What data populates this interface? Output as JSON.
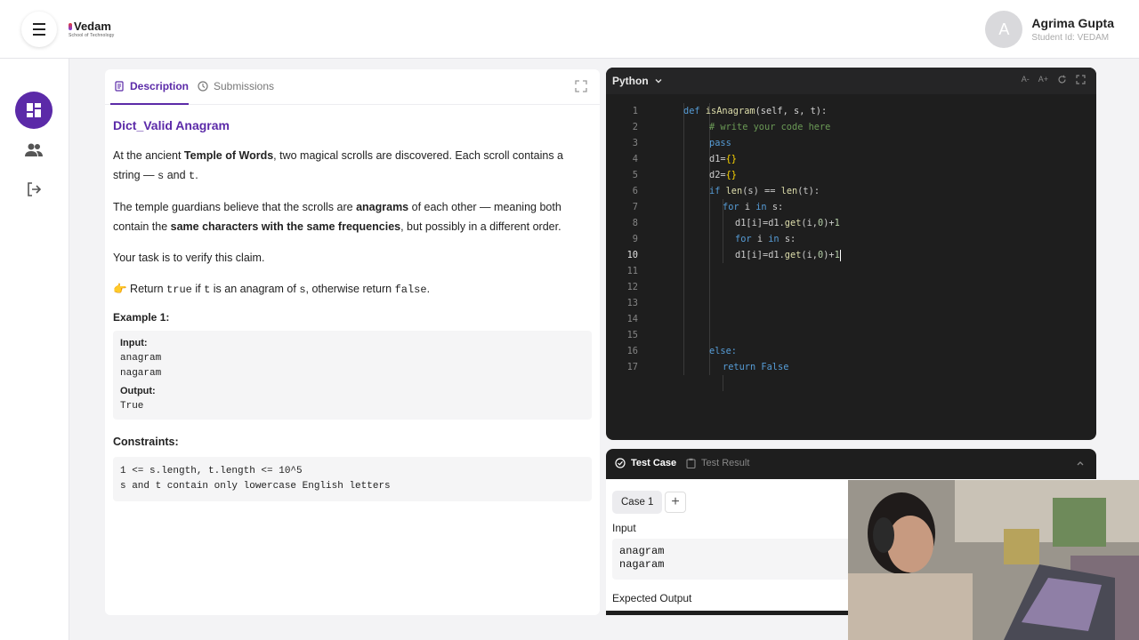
{
  "header": {
    "logo_text": "Vedam",
    "logo_sub": "School of Technology",
    "user_initial": "A",
    "user_name": "Agrima Gupta",
    "student_id": "Student Id: VEDAM"
  },
  "description_panel": {
    "tabs": [
      {
        "label": "Description",
        "icon": "document-icon",
        "active": true
      },
      {
        "label": "Submissions",
        "icon": "clock-icon",
        "active": false
      }
    ],
    "title": "Dict_Valid Anagram",
    "p1_a": "At the ancient ",
    "p1_b": "Temple of Words",
    "p1_c": ", two magical scrolls are discovered. Each scroll contains a string — ",
    "p1_s": "s",
    "p1_and": " and ",
    "p1_t": "t",
    "p1_end": ".",
    "p2_a": "The temple guardians believe that the scrolls are ",
    "p2_b": "anagrams",
    "p2_c": " of each other — meaning both contain the ",
    "p2_d": "same characters with the same frequencies",
    "p2_e": ", but possibly in a different order.",
    "p3": "Your task is to verify this claim.",
    "p4_emoji": "👉",
    "p4_a": " Return ",
    "p4_true": "true",
    "p4_b": " if ",
    "p4_t": "t",
    "p4_c": " is an anagram of ",
    "p4_s": "s",
    "p4_d": ", otherwise return ",
    "p4_false": "false",
    "p4_end": ".",
    "example_title": "Example 1:",
    "example_input_label": "Input:",
    "example_input_1": "anagram",
    "example_input_2": "nagaram",
    "example_output_label": "Output:",
    "example_output": "True",
    "constraints_title": "Constraints:",
    "constraint_1": "1 <= s.length, t.length <= 10^5",
    "constraint_2": "s and t contain only lowercase English letters"
  },
  "editor": {
    "language": "Python",
    "tools": [
      "A-",
      "A+",
      "reset-icon",
      "fullscreen-icon"
    ],
    "current_line": 10,
    "lines": [
      "def isAnagram(self, s, t):",
      "# write your code here",
      "pass",
      "d1={}",
      "d2={}",
      "if len(s) == len(t):",
      "for i in s:",
      "d1[i]=d1.get(i,0)+1",
      "for i in s:",
      "d1[i]=d1.get(i,0)+1",
      "",
      "",
      "",
      "",
      "",
      "else:",
      "return False"
    ],
    "line_numbers": [
      "1",
      "2",
      "3",
      "4",
      "5",
      "6",
      "7",
      "8",
      "9",
      "10",
      "11",
      "12",
      "13",
      "14",
      "15",
      "16",
      "17"
    ]
  },
  "test_panel": {
    "tabs": [
      {
        "label": "Test Case",
        "icon": "check-circle-icon",
        "active": true
      },
      {
        "label": "Test Result",
        "icon": "clipboard-icon",
        "active": false
      }
    ],
    "case_label": "Case 1",
    "add_label": "+",
    "input_label": "Input",
    "input_value": "anagram\nnagaram",
    "expected_label": "Expected Output"
  }
}
